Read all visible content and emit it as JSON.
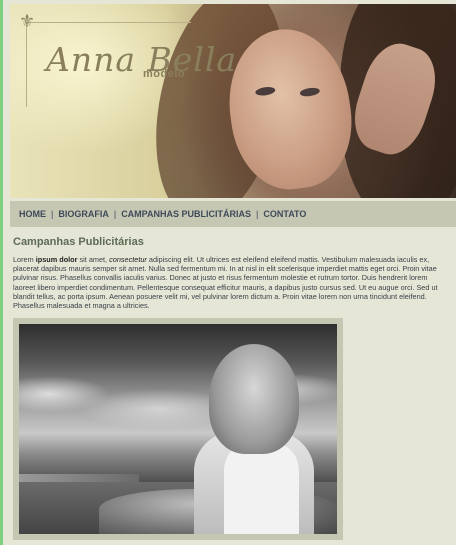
{
  "header": {
    "logo_name": "Anna Bella",
    "logo_sub": "modelo",
    "ornament_icon": "fleur-de-lis-icon"
  },
  "nav": {
    "items": [
      "HOME",
      "BIOGRAFIA",
      "CAMPANHAS PUBLICITÁRIAS",
      "CONTATO"
    ],
    "separator": "|"
  },
  "content": {
    "title": "Campanhas Publicitárias",
    "p_lorem": "Lorem ",
    "p_bold": "ipsum dolor",
    "p_mid": " sit amet, ",
    "p_italic": "consectetur",
    "p_rest": " adipiscing elit. Ut ultrices est eleifend eleifend mattis. Vestibulum malesuada iaculis ex, placerat dapibus mauris semper sit amet. Nulla sed fermentum mi. In at nisl in elit scelerisque imperdiet mattis eget orci. Proin vitae pulvinar risus. Phasellus convallis iaculis varius. Donec at justo et risus fermentum molestie et rutrum tortor. Duis hendrerit lorem laoreet libero imperdiet condimentum. Pellentesque consequat efficitur mauris, a dapibus justo cursus sed. Ut eu augue orci. Sed ut blandit tellus, ac porta ipsum. Aenean posuere velit mi, vel pulvinar lorem dictum a. Proin vitae lorem non urna tincidunt eleifend. Phasellus malesuada et magna a ultricies."
  },
  "colors": {
    "page_bg": "#e5e6d6",
    "nav_bg": "#c6c7b3",
    "nav_text": "#3e4a5a",
    "title_text": "#5d6a55",
    "logo_text": "#8a7f5c",
    "left_border": "#7fd07f"
  }
}
